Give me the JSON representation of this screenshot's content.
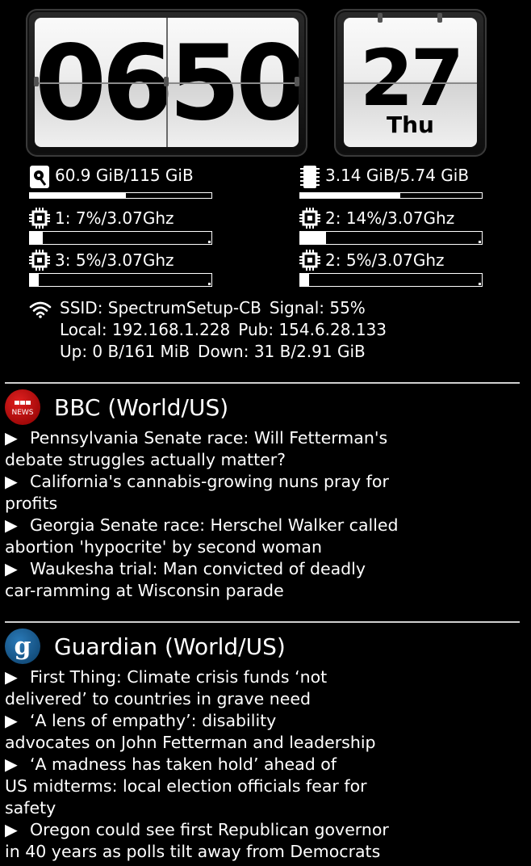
{
  "clock": {
    "time": "0650",
    "day_number": "27",
    "day_name": "Thu"
  },
  "disk": {
    "label": "60.9 GiB/115 GiB",
    "fraction": 0.53,
    "icon": "hard-disk-icon"
  },
  "memory": {
    "label": "3.14 GiB/5.74 GiB",
    "fraction": 0.55,
    "icon": "memory-chip-icon"
  },
  "cpu": [
    {
      "label": "1: 7%/3.07Ghz",
      "fraction": 0.07,
      "icon": "cpu-icon"
    },
    {
      "label": "2: 14%/3.07Ghz",
      "fraction": 0.14,
      "icon": "cpu-icon"
    },
    {
      "label": "3: 5%/3.07Ghz",
      "fraction": 0.05,
      "icon": "cpu-icon"
    },
    {
      "label": "2: 5%/3.07Ghz",
      "fraction": 0.05,
      "icon": "cpu-icon"
    }
  ],
  "network": {
    "icon": "wifi-icon",
    "ssid": "SSID: SpectrumSetup-CB",
    "signal": "Signal: 55%",
    "local": "Local: 192.168.1.228",
    "pub": "Pub: 154.6.28.133",
    "up": "Up: 0 B/161 MiB",
    "down": "Down: 31 B/2.91 GiB"
  },
  "feeds": [
    {
      "title": "BBC (World/US)",
      "logo_text": "BBC NEWS",
      "logo_color": "#b80000",
      "items": [
        [
          "Pennsylvania Senate race: Will Fetterman's",
          "debate struggles actually matter?"
        ],
        [
          "California's cannabis-growing nuns pray for",
          "profits"
        ],
        [
          "Georgia Senate race: Herschel Walker called",
          "abortion 'hypocrite' by second woman"
        ],
        [
          "Waukesha trial: Man convicted of deadly",
          "car-ramming at Wisconsin parade"
        ]
      ]
    },
    {
      "title": "Guardian (World/US)",
      "logo_text": "g",
      "logo_color": "#052962",
      "items": [
        [
          "First Thing: Climate crisis funds ‘not",
          "delivered’ to countries in grave need"
        ],
        [
          "‘A lens of empathy’: disability",
          "advocates on John Fetterman and leadership"
        ],
        [
          "‘A madness has taken hold’ ahead of",
          "US midterms: local election officials fear for",
          "safety"
        ],
        [
          "Oregon could see first Republican governor",
          "in 40 years as polls tilt away from Democrats"
        ]
      ]
    }
  ],
  "bullet": "▶"
}
